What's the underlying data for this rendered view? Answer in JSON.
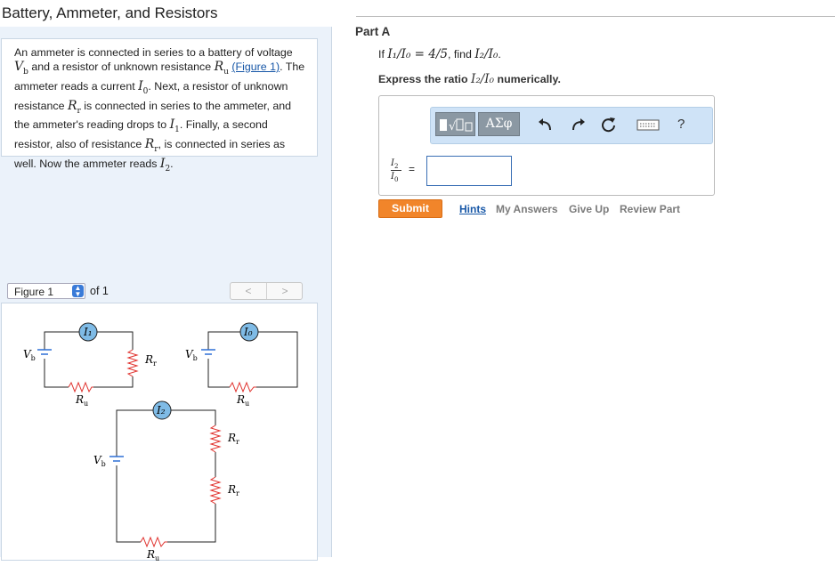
{
  "page": {
    "title": "Battery, Ammeter, and Resistors"
  },
  "problem": {
    "t1": "An ammeter is connected in series to a battery of voltage",
    "sym_Vb": "V",
    "sub_b": "b",
    "t2": "and a resistor of unknown resistance",
    "sym_Ru": "R",
    "sub_u": "u",
    "figure_link": "(Figure 1)",
    "t3": ". The ammeter reads a current",
    "sym_I0": "I",
    "sub_0": "0",
    "t4": ". Next, a resistor of unknown resistance",
    "sym_Rr": "R",
    "sub_r": "r",
    "t5": "is connected in series to the ammeter, and the ammeter's reading drops to",
    "sym_I1": "I",
    "sub_1": "1",
    "t6": ". Finally, a second resistor, also of resistance",
    "sym_Rr2": "R",
    "sub_r2": "r",
    "t7": ", is connected in series as well. Now the ammeter reads",
    "sym_I2": "I",
    "sub_2": "2",
    "t8": "."
  },
  "figure_nav": {
    "selected": "Figure 1",
    "of_label": "of 1",
    "prev_label": "<",
    "next_label": ">"
  },
  "figure": {
    "labels": {
      "ammeter_1": "I₁",
      "ammeter_0": "I₀",
      "ammeter_2": "I₂",
      "vb": "V",
      "vb_sub": "b",
      "ru": "R",
      "ru_sub": "u",
      "rr": "R",
      "rr_sub": "r"
    },
    "colors": {
      "resistor": "#e0312d",
      "battery": "#2d6fd6",
      "ammeter_fill": "#7fbbe6",
      "wire": "#222222"
    }
  },
  "part": {
    "title": "Part A",
    "q_if": "If",
    "q_expr": "I₁/I₀ = 4/5",
    "q_find": ", find",
    "q_target": "I₂/I₀",
    "q_end": ".",
    "instr_a": "Express the ratio",
    "instr_sym": "I₂/I₀",
    "instr_b": "numerically."
  },
  "answer": {
    "toolbar_btn_greek": "ΑΣφ",
    "toolbar_icons": [
      "templates-icon",
      "greek-icon",
      "undo-icon",
      "redo-icon",
      "reset-icon",
      "keyboard-icon",
      "help-icon"
    ],
    "help_label": "?",
    "label_num": "I",
    "label_num_sub": "2",
    "label_den": "I",
    "label_den_sub": "0",
    "equals": "=",
    "input_value": ""
  },
  "actions": {
    "submit": "Submit",
    "hints": "Hints",
    "my_answers": "My Answers",
    "give_up": "Give Up",
    "review_part": "Review Part"
  },
  "colors": {
    "accent_orange": "#f1852a",
    "link_blue": "#1757a7",
    "panel_bg": "#ebf2fa",
    "toolbar_bg": "#cfe3f7"
  }
}
